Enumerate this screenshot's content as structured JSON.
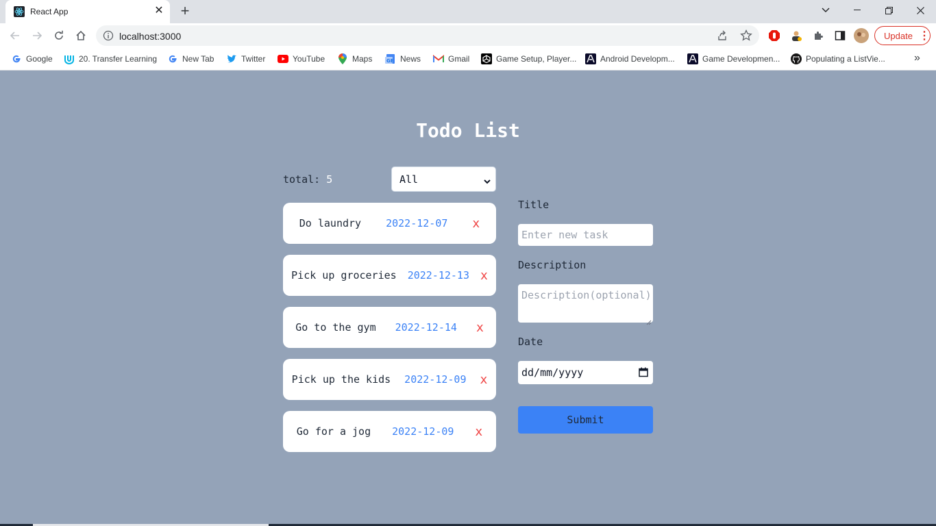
{
  "browser": {
    "tab_title": "React App",
    "url": "localhost:3000",
    "update_label": "Update",
    "bookmarks": [
      {
        "label": "Google",
        "icon": "google-icon"
      },
      {
        "label": "20. Transfer Learning",
        "icon": "udacity-icon"
      },
      {
        "label": "New Tab",
        "icon": "google-icon"
      },
      {
        "label": "Twitter",
        "icon": "twitter-icon"
      },
      {
        "label": "YouTube",
        "icon": "youtube-icon"
      },
      {
        "label": "Maps",
        "icon": "maps-icon"
      },
      {
        "label": "News",
        "icon": "news-icon"
      },
      {
        "label": "Gmail",
        "icon": "gmail-icon"
      },
      {
        "label": "Game Setup, Player...",
        "icon": "unity-icon"
      },
      {
        "label": "Android Developm...",
        "icon": "android-dev-icon"
      },
      {
        "label": "Game Developmen...",
        "icon": "game-dev-icon"
      },
      {
        "label": "Populating a ListVie...",
        "icon": "github-icon"
      }
    ]
  },
  "app": {
    "title": "Todo List",
    "total_label": "total:",
    "total_value": "5",
    "filter_value": "All",
    "todos": [
      {
        "title": "Do laundry",
        "date": "2022-12-07",
        "delete": "x"
      },
      {
        "title": "Pick up groceries",
        "date": "2022-12-13",
        "delete": "x"
      },
      {
        "title": "Go to the gym",
        "date": "2022-12-14",
        "delete": "x"
      },
      {
        "title": "Pick up the kids",
        "date": "2022-12-09",
        "delete": "x"
      },
      {
        "title": "Go for a jog",
        "date": "2022-12-09",
        "delete": "x"
      }
    ],
    "form": {
      "title_label": "Title",
      "title_placeholder": "Enter new task",
      "description_label": "Description",
      "description_placeholder": "Description(optional)",
      "date_label": "Date",
      "date_placeholder": "dd/mm/yyyy",
      "submit_label": "Submit"
    }
  },
  "colors": {
    "page_background": "#94a3b8",
    "accent": "#3b82f6",
    "delete": "#ef4444",
    "update": "#d93025"
  }
}
